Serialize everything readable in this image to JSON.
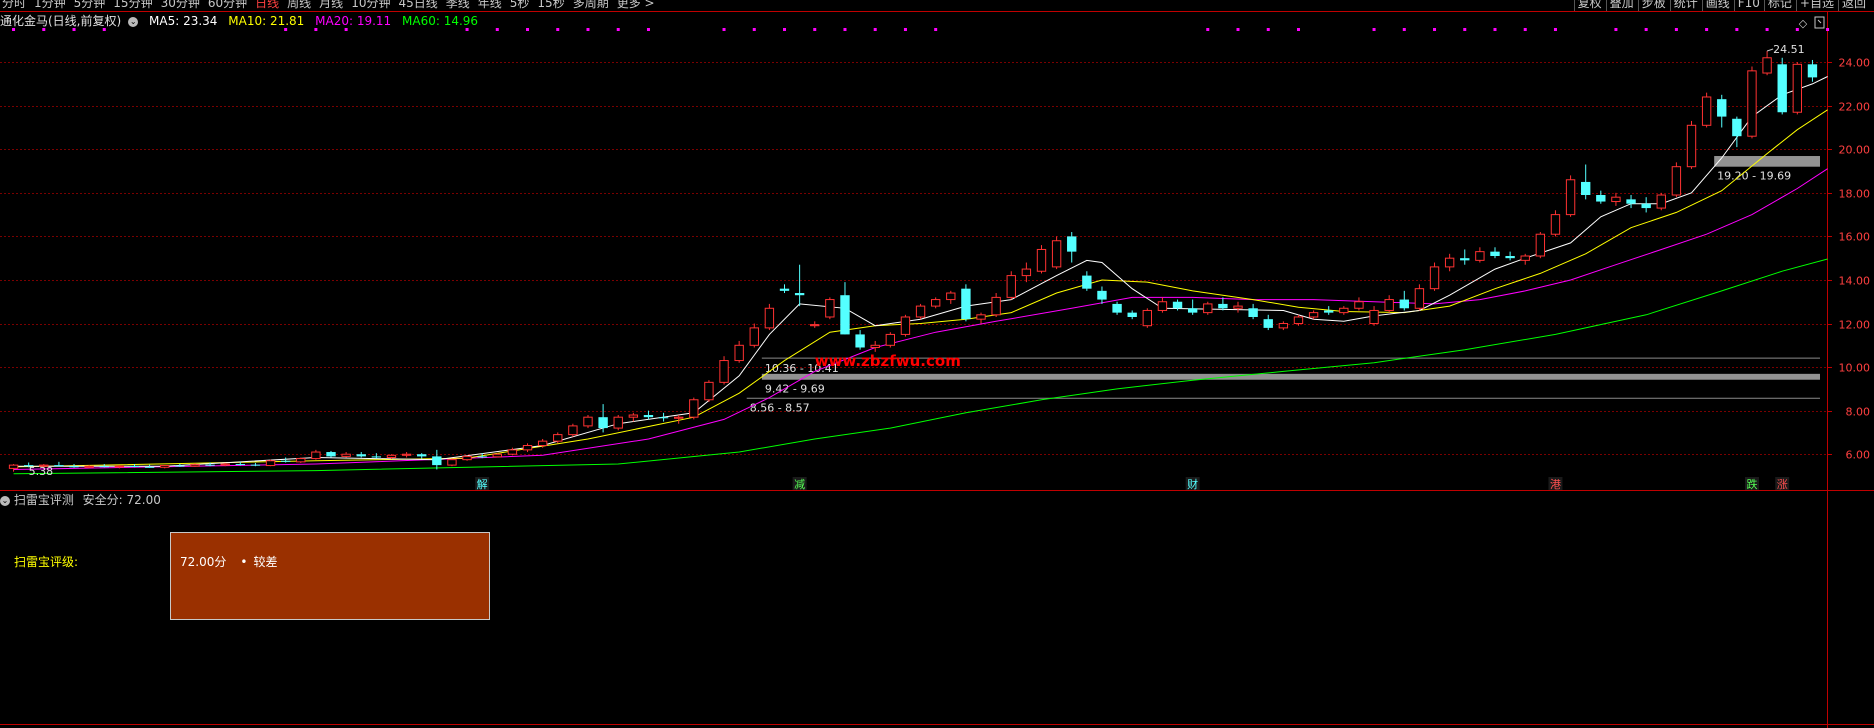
{
  "toolbar": {
    "periods": [
      "分时",
      "1分钟",
      "5分钟",
      "15分钟",
      "30分钟",
      "60分钟",
      "日线",
      "周线",
      "月线",
      "10分钟",
      "45日线",
      "季线",
      "年线",
      "5秒",
      "15秒",
      "多周期",
      "更多 >"
    ],
    "active_period": "日线",
    "right_buttons": [
      "复权",
      "叠加",
      "步板",
      "统计",
      "画线",
      "F10",
      "标记",
      "+自选",
      "返回"
    ]
  },
  "stock": {
    "title": "通化金马(日线,前复权)",
    "ma5_label": "MA5: 23.34",
    "ma10_label": "MA10: 21.81",
    "ma20_label": "MA20: 19.11",
    "ma60_label": "MA60: 14.96"
  },
  "colors": {
    "ma5": "#ffffff",
    "ma10": "#ffff00",
    "ma20": "#ff00ff",
    "ma60": "#00ff00",
    "up": "#ff3232",
    "down": "#54ffff",
    "grid": "#7a0000",
    "axis": "#c00000",
    "watermark": "#ff0000"
  },
  "watermark": "www.zbzfwu.com",
  "chart_data": {
    "type": "candlestick",
    "title": "通化金马(日线,前复权)",
    "ylim": [
      5.0,
      25.2
    ],
    "y_ticks": [
      6,
      8,
      10,
      12,
      14,
      16,
      18,
      20,
      22,
      24
    ],
    "y_tick_labels": [
      "6.00",
      "8.00",
      "10.00",
      "12.00",
      "14.00",
      "16.00",
      "18.00",
      "20.00",
      "22.00",
      "24.00"
    ],
    "low_label": "5.38",
    "high_label": "24.51",
    "ohlc": [
      [
        5.35,
        5.55,
        5.2,
        5.5
      ],
      [
        5.5,
        5.62,
        5.4,
        5.45
      ],
      [
        5.45,
        5.55,
        5.35,
        5.5
      ],
      [
        5.5,
        5.65,
        5.45,
        5.45
      ],
      [
        5.45,
        5.55,
        5.38,
        5.4
      ],
      [
        5.4,
        5.5,
        5.35,
        5.45
      ],
      [
        5.45,
        5.55,
        5.4,
        5.42
      ],
      [
        5.42,
        5.5,
        5.35,
        5.46
      ],
      [
        5.46,
        5.55,
        5.4,
        5.42
      ],
      [
        5.42,
        5.52,
        5.38,
        5.4
      ],
      [
        5.4,
        5.5,
        5.35,
        5.48
      ],
      [
        5.48,
        5.56,
        5.42,
        5.45
      ],
      [
        5.45,
        5.58,
        5.42,
        5.52
      ],
      [
        5.52,
        5.62,
        5.45,
        5.5
      ],
      [
        5.5,
        5.6,
        5.45,
        5.55
      ],
      [
        5.55,
        5.65,
        5.48,
        5.52
      ],
      [
        5.52,
        5.6,
        5.45,
        5.48
      ],
      [
        5.48,
        5.75,
        5.45,
        5.7
      ],
      [
        5.7,
        5.85,
        5.62,
        5.65
      ],
      [
        5.65,
        5.85,
        5.6,
        5.8
      ],
      [
        5.8,
        6.2,
        5.75,
        6.1
      ],
      [
        6.1,
        6.15,
        5.85,
        5.9
      ],
      [
        5.9,
        6.1,
        5.85,
        6.0
      ],
      [
        6.0,
        6.1,
        5.85,
        5.9
      ],
      [
        5.9,
        6.05,
        5.8,
        5.85
      ],
      [
        5.85,
        6.0,
        5.78,
        5.95
      ],
      [
        5.95,
        6.1,
        5.85,
        6.0
      ],
      [
        6.0,
        6.05,
        5.8,
        5.9
      ],
      [
        5.9,
        6.2,
        5.3,
        5.5
      ],
      [
        5.5,
        5.8,
        5.45,
        5.75
      ],
      [
        5.75,
        5.95,
        5.7,
        5.9
      ],
      [
        5.9,
        6.05,
        5.82,
        5.88
      ],
      [
        5.88,
        6.05,
        5.85,
        6.0
      ],
      [
        6.0,
        6.3,
        5.95,
        6.2
      ],
      [
        6.2,
        6.5,
        6.1,
        6.4
      ],
      [
        6.4,
        6.7,
        6.3,
        6.6
      ],
      [
        6.6,
        7.0,
        6.5,
        6.9
      ],
      [
        6.9,
        7.4,
        6.8,
        7.3
      ],
      [
        7.3,
        7.8,
        7.2,
        7.7
      ],
      [
        7.7,
        8.3,
        7.0,
        7.2
      ],
      [
        7.2,
        7.8,
        7.1,
        7.7
      ],
      [
        7.7,
        7.9,
        7.5,
        7.8
      ],
      [
        7.8,
        8.0,
        7.6,
        7.7
      ],
      [
        7.7,
        7.9,
        7.5,
        7.65
      ],
      [
        7.65,
        7.8,
        7.4,
        7.7
      ],
      [
        7.7,
        8.6,
        7.6,
        8.5
      ],
      [
        8.5,
        9.4,
        8.4,
        9.3
      ],
      [
        9.3,
        10.5,
        9.2,
        10.3
      ],
      [
        10.3,
        11.2,
        10.2,
        11.0
      ],
      [
        11.0,
        12.0,
        10.9,
        11.8
      ],
      [
        11.8,
        12.9,
        11.7,
        12.7
      ],
      [
        13.6,
        13.8,
        13.4,
        13.5
      ],
      [
        13.4,
        14.7,
        12.8,
        13.3
      ],
      [
        11.9,
        12.1,
        11.8,
        11.95
      ],
      [
        12.3,
        13.2,
        12.2,
        13.1
      ],
      [
        13.3,
        13.9,
        11.5,
        11.5
      ],
      [
        11.5,
        11.7,
        10.8,
        10.9
      ],
      [
        10.9,
        11.2,
        10.7,
        11.0
      ],
      [
        11.0,
        11.6,
        10.9,
        11.5
      ],
      [
        11.5,
        12.4,
        11.4,
        12.3
      ],
      [
        12.3,
        12.9,
        12.2,
        12.8
      ],
      [
        12.8,
        13.2,
        12.7,
        13.1
      ],
      [
        13.1,
        13.5,
        12.9,
        13.4
      ],
      [
        13.6,
        13.8,
        12.1,
        12.2
      ],
      [
        12.2,
        12.5,
        12.0,
        12.4
      ],
      [
        12.4,
        13.4,
        12.3,
        13.2
      ],
      [
        13.2,
        14.4,
        13.1,
        14.2
      ],
      [
        14.2,
        14.8,
        13.9,
        14.5
      ],
      [
        14.4,
        15.6,
        14.3,
        15.4
      ],
      [
        14.6,
        16.0,
        14.5,
        15.8
      ],
      [
        16.0,
        16.2,
        14.8,
        15.3
      ],
      [
        14.2,
        14.4,
        13.5,
        13.6
      ],
      [
        13.5,
        13.7,
        12.9,
        13.1
      ],
      [
        12.9,
        13.0,
        12.4,
        12.5
      ],
      [
        12.5,
        12.6,
        12.2,
        12.3
      ],
      [
        11.9,
        12.7,
        11.8,
        12.6
      ],
      [
        12.6,
        13.2,
        12.5,
        13.0
      ],
      [
        13.0,
        13.1,
        12.6,
        12.7
      ],
      [
        12.7,
        13.1,
        12.4,
        12.5
      ],
      [
        12.5,
        13.0,
        12.4,
        12.9
      ],
      [
        12.9,
        13.2,
        12.6,
        12.7
      ],
      [
        12.7,
        13.0,
        12.5,
        12.8
      ],
      [
        12.7,
        12.9,
        12.2,
        12.3
      ],
      [
        12.2,
        12.4,
        11.7,
        11.8
      ],
      [
        11.8,
        12.1,
        11.7,
        12.0
      ],
      [
        12.0,
        12.4,
        11.9,
        12.3
      ],
      [
        12.3,
        12.6,
        12.2,
        12.5
      ],
      [
        12.6,
        12.8,
        12.4,
        12.5
      ],
      [
        12.5,
        12.8,
        12.4,
        12.7
      ],
      [
        12.7,
        13.2,
        12.6,
        13.0
      ],
      [
        12.0,
        12.8,
        11.9,
        12.6
      ],
      [
        12.6,
        13.3,
        12.5,
        13.1
      ],
      [
        13.1,
        13.5,
        12.6,
        12.7
      ],
      [
        12.7,
        13.8,
        12.6,
        13.6
      ],
      [
        13.6,
        14.8,
        13.5,
        14.6
      ],
      [
        14.6,
        15.2,
        14.4,
        15.0
      ],
      [
        15.0,
        15.4,
        14.7,
        14.9
      ],
      [
        14.9,
        15.5,
        14.8,
        15.3
      ],
      [
        15.3,
        15.5,
        15.0,
        15.1
      ],
      [
        15.1,
        15.3,
        14.9,
        15.0
      ],
      [
        14.9,
        15.2,
        14.7,
        15.1
      ],
      [
        15.1,
        16.2,
        15.0,
        16.1
      ],
      [
        16.1,
        17.2,
        16.0,
        17.0
      ],
      [
        17.0,
        18.8,
        16.9,
        18.6
      ],
      [
        18.5,
        19.3,
        17.7,
        17.9
      ],
      [
        17.9,
        18.1,
        17.5,
        17.6
      ],
      [
        17.6,
        18.0,
        17.4,
        17.8
      ],
      [
        17.7,
        17.9,
        17.3,
        17.5
      ],
      [
        17.5,
        17.8,
        17.1,
        17.3
      ],
      [
        17.3,
        18.0,
        17.2,
        17.9
      ],
      [
        17.9,
        19.4,
        17.8,
        19.2
      ],
      [
        19.2,
        21.3,
        19.1,
        21.1
      ],
      [
        21.1,
        22.6,
        21.0,
        22.4
      ],
      [
        22.3,
        22.5,
        21.0,
        21.5
      ],
      [
        21.4,
        21.5,
        20.1,
        20.6
      ],
      [
        20.6,
        23.8,
        20.5,
        23.6
      ],
      [
        23.5,
        24.51,
        23.4,
        24.2
      ],
      [
        23.9,
        24.2,
        21.6,
        21.7
      ],
      [
        21.7,
        24.0,
        21.6,
        23.9
      ],
      [
        23.9,
        24.1,
        23.1,
        23.3
      ]
    ],
    "ma5": [
      [
        0,
        5.45
      ],
      [
        10,
        5.45
      ],
      [
        20,
        5.85
      ],
      [
        28,
        5.75
      ],
      [
        35,
        6.4
      ],
      [
        40,
        7.4
      ],
      [
        45,
        7.9
      ],
      [
        48,
        9.6
      ],
      [
        50,
        11.5
      ],
      [
        52,
        12.9
      ],
      [
        55,
        12.7
      ],
      [
        57,
        11.9
      ],
      [
        60,
        12.2
      ],
      [
        63,
        12.8
      ],
      [
        66,
        13.1
      ],
      [
        69,
        14.2
      ],
      [
        71,
        14.9
      ],
      [
        72,
        14.8
      ],
      [
        74,
        13.6
      ],
      [
        76,
        12.7
      ],
      [
        80,
        12.65
      ],
      [
        84,
        12.6
      ],
      [
        86,
        12.2
      ],
      [
        88,
        12.1
      ],
      [
        90,
        12.35
      ],
      [
        93,
        12.6
      ],
      [
        95,
        13.3
      ],
      [
        98,
        14.5
      ],
      [
        100,
        15.0
      ],
      [
        103,
        15.7
      ],
      [
        105,
        16.9
      ],
      [
        107,
        17.5
      ],
      [
        109,
        17.5
      ],
      [
        111,
        18.0
      ],
      [
        113,
        19.6
      ],
      [
        115,
        21.5
      ],
      [
        117,
        22.5
      ],
      [
        119,
        23.0
      ],
      [
        120,
        23.34
      ]
    ],
    "ma10": [
      [
        0,
        5.42
      ],
      [
        20,
        5.7
      ],
      [
        30,
        5.82
      ],
      [
        38,
        6.7
      ],
      [
        45,
        7.7
      ],
      [
        48,
        8.8
      ],
      [
        51,
        10.3
      ],
      [
        54,
        11.6
      ],
      [
        57,
        11.9
      ],
      [
        60,
        12.0
      ],
      [
        63,
        12.2
      ],
      [
        66,
        12.5
      ],
      [
        69,
        13.4
      ],
      [
        72,
        14.0
      ],
      [
        75,
        13.9
      ],
      [
        78,
        13.5
      ],
      [
        82,
        13.1
      ],
      [
        85,
        12.75
      ],
      [
        88,
        12.55
      ],
      [
        92,
        12.5
      ],
      [
        95,
        12.8
      ],
      [
        98,
        13.6
      ],
      [
        101,
        14.3
      ],
      [
        104,
        15.2
      ],
      [
        107,
        16.4
      ],
      [
        110,
        17.1
      ],
      [
        113,
        18.1
      ],
      [
        116,
        19.8
      ],
      [
        118,
        20.9
      ],
      [
        120,
        21.81
      ]
    ],
    "ma20": [
      [
        0,
        5.3
      ],
      [
        20,
        5.55
      ],
      [
        35,
        5.95
      ],
      [
        42,
        6.7
      ],
      [
        47,
        7.6
      ],
      [
        50,
        8.6
      ],
      [
        53,
        9.8
      ],
      [
        57,
        10.9
      ],
      [
        61,
        11.6
      ],
      [
        65,
        12.1
      ],
      [
        70,
        12.7
      ],
      [
        74,
        13.2
      ],
      [
        78,
        13.2
      ],
      [
        82,
        13.1
      ],
      [
        86,
        13.1
      ],
      [
        90,
        13.0
      ],
      [
        94,
        12.9
      ],
      [
        97,
        13.1
      ],
      [
        100,
        13.5
      ],
      [
        103,
        14.0
      ],
      [
        106,
        14.7
      ],
      [
        109,
        15.4
      ],
      [
        112,
        16.1
      ],
      [
        115,
        17.0
      ],
      [
        118,
        18.2
      ],
      [
        120,
        19.11
      ]
    ],
    "ma60": [
      [
        0,
        5.1
      ],
      [
        20,
        5.25
      ],
      [
        40,
        5.55
      ],
      [
        48,
        6.1
      ],
      [
        53,
        6.7
      ],
      [
        58,
        7.2
      ],
      [
        63,
        7.9
      ],
      [
        68,
        8.5
      ],
      [
        73,
        9.0
      ],
      [
        78,
        9.4
      ],
      [
        84,
        9.8
      ],
      [
        90,
        10.2
      ],
      [
        96,
        10.8
      ],
      [
        102,
        11.5
      ],
      [
        108,
        12.4
      ],
      [
        113,
        13.5
      ],
      [
        117,
        14.4
      ],
      [
        120,
        14.96
      ]
    ],
    "support_bands": [
      {
        "label": "19.20 - 19.69",
        "low": 19.2,
        "high": 19.69,
        "from": 113
      },
      {
        "label": "10.36 - 10.41",
        "low": 10.36,
        "high": 10.41,
        "from": 50
      },
      {
        "label": "9.42 - 9.69",
        "low": 9.42,
        "high": 9.69,
        "from": 50
      },
      {
        "label": "8.56 - 8.57",
        "low": 8.56,
        "high": 8.57,
        "from": 49
      }
    ],
    "event_markers": [
      {
        "label": "解",
        "index": 31,
        "color": "#54ffff"
      },
      {
        "label": "减",
        "index": 52,
        "color": "#55ff55"
      },
      {
        "label": "财",
        "index": 78,
        "color": "#54ffff"
      },
      {
        "label": "港",
        "index": 102,
        "color": "#ff5050"
      },
      {
        "label": "跌",
        "index": 115,
        "color": "#55ff55"
      },
      {
        "label": "涨",
        "index": 117,
        "color": "#ff5050"
      }
    ],
    "dot_rows": [
      [
        0,
        6
      ],
      [
        18,
        22
      ],
      [
        30,
        43
      ],
      [
        47,
        62
      ],
      [
        79,
        86
      ],
      [
        90,
        103
      ],
      [
        106,
        120
      ]
    ]
  },
  "indicator": {
    "title": "扫雷宝评测",
    "score_label": "安全分: 72.00",
    "rating_label": "扫雷宝评级:",
    "score_value": "72.00分",
    "bullet": "•",
    "level": "较差"
  }
}
